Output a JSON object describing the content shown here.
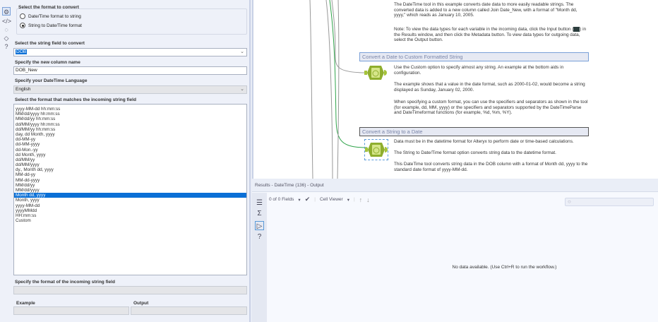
{
  "config": {
    "format_group_label": "Select the format to convert",
    "radio_options": [
      {
        "label": "Date/Time format to string",
        "selected": false
      },
      {
        "label": "String to Date/Time format",
        "selected": true
      }
    ],
    "string_field_label": "Select the string field to convert",
    "string_field_value": "DOB",
    "new_column_label": "Specify the new column name",
    "new_column_value": "DOB_New",
    "language_label": "Specify your DateTime Language",
    "language_value": "English",
    "format_list_label": "Select the format that matches the incoming string field",
    "formats": [
      "yyyy-MM-dd hh:mm:ss",
      "MM/dd/yyyy hh:mm:ss",
      "MM/dd/yy hh:mm:ss",
      "dd/MM/yyyy hh:mm:ss",
      "dd/MM/yy hh:mm:ss",
      "day, dd Month, yyyy",
      "dd-MM-yy",
      "dd-MM-yyyy",
      "dd-Mon.-yy",
      "dd Month, yyyy",
      "dd/MM/yy",
      "dd/MM/yyyy",
      "dy., Month dd, yyyy",
      "MM-dd-yy",
      "MM-dd-yyyy",
      "MM/dd/yy",
      "MM/dd/yyyy",
      "Month dd, yyyy",
      "Month, yyyy",
      "yyyy-MM-dd",
      "yyyyMMdd",
      "HH:mm:ss",
      "Custom"
    ],
    "selected_format": "Month dd, yyyy",
    "incoming_format_label": "Specify the format of the incoming string field",
    "example_label": "Example",
    "output_label": "Output"
  },
  "canvas": {
    "intro": "The DateTime tool in this example converts date data to more easily readable strings. The converted data is added to a new column called Join Date_New, with a format of \"Month dd, yyyy,\" which reads as January 10, 2005.",
    "note_before": "Note: To view the data types for each variable in the incoming data, click the Input button (",
    "note_after": ") in the Results window, and then click the Metadata button. To view data types for outgoing data, select the Output button.",
    "section1_title": "Convert a Date to Custom Formatted String",
    "section1_p1": "Use the Custom option to specify almost any string. An example at the bottom aids in configuration.",
    "section1_p2": "The example shows that a value in the date format, such as 2000-01-02, would become a string displayed as Sunday, January 02, 2000.",
    "section1_p3": "When specifying a custom format, you can use the specifiers and separators as shown in the tool (for example, dd, MM, yyyy) or the specifiers and separators supported by the DateTimeParse and DateTimeformat functions (for example, %d, %m, %Y).",
    "section2_title": "Convert a String to a Date",
    "section2_p1": "Data must be in the datetime format for Alteryx to perform date or time-based calculations.",
    "section2_p2": "The String to Date/Time format option converts string data to the datetime format.",
    "section2_p3": "This DateTime tool converts string data in the DOB column with a format of Month dd, yyyy to the standard date format of yyyy-MM-dd."
  },
  "results": {
    "title": "Results - DateTime (136) - Output",
    "fields": "0 of 0 Fields",
    "cell_viewer": "Cell Viewer",
    "no_data": "No data available. (Use Ctrl+R to run the workflow.)"
  }
}
